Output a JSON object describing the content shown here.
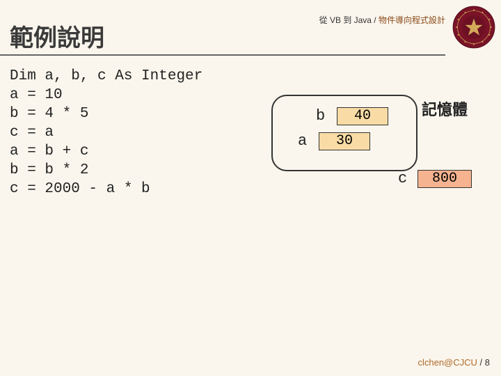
{
  "header": {
    "left": "從 VB 到 Java",
    "sep": " / ",
    "right": "物件導向程式設計"
  },
  "title": "範例說明",
  "code_lines": [
    "Dim a, b, c As Integer",
    "a = 10",
    "b = 4 * 5",
    "c = a",
    "a = b + c",
    "b = b * 2",
    "c = 2000 - a * b"
  ],
  "memory": {
    "title": "記憶體",
    "vars": {
      "a": {
        "label": "a",
        "value": "30"
      },
      "b": {
        "label": "b",
        "value": "40"
      },
      "c": {
        "label": "c",
        "value": "800"
      }
    }
  },
  "footer": {
    "author": "clchen@CJCU",
    "sep": " / ",
    "page": "8"
  }
}
